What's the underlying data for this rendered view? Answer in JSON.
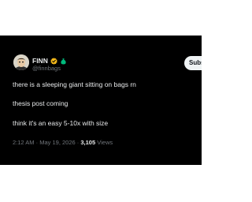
{
  "tweet": {
    "author": {
      "display_name": "FINN",
      "handle": "@finnbags",
      "verified_badge_icon": "verified-badge-icon",
      "affiliate_badge_icon": "money-bag-icon"
    },
    "subscribe_label": "Subscribe",
    "body_lines": [
      "there is a sleeping giant sitting on bags rn",
      "thesis post coming",
      "think it's an easy 5-10x with size"
    ],
    "meta": {
      "time": "2:12 AM",
      "separator": "·",
      "date": "May 19, 2026",
      "views_count": "3,105",
      "views_label": "Views"
    }
  },
  "colors": {
    "background": "#000000",
    "text": "#e7e9ea",
    "secondary_text": "#71767b",
    "verified": "#f4b81a",
    "affiliate": "#00ba7c"
  }
}
